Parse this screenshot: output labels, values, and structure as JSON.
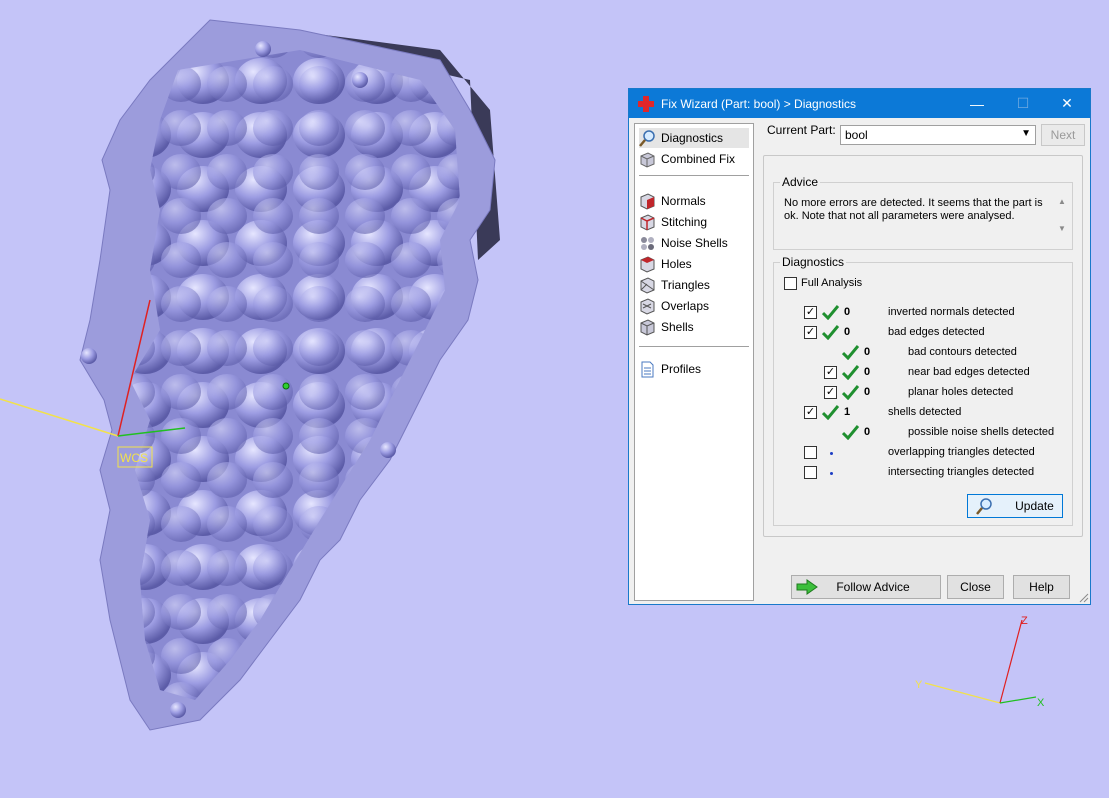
{
  "dialog": {
    "title": "Fix Wizard (Part: bool) > Diagnostics",
    "controls": {
      "minimize": "—",
      "maximize": "☐",
      "close": "✕"
    }
  },
  "nav": {
    "items": [
      {
        "label": "Diagnostics",
        "icon": "magnifier-icon",
        "selected": true
      },
      {
        "label": "Combined Fix",
        "icon": "combined-fix-icon"
      },
      {
        "label": "Normals",
        "icon": "normals-cube-icon"
      },
      {
        "label": "Stitching",
        "icon": "stitching-cube-icon"
      },
      {
        "label": "Noise Shells",
        "icon": "noise-shells-icon"
      },
      {
        "label": "Holes",
        "icon": "holes-cube-icon"
      },
      {
        "label": "Triangles",
        "icon": "triangles-cube-icon"
      },
      {
        "label": "Overlaps",
        "icon": "overlaps-cube-icon"
      },
      {
        "label": "Shells",
        "icon": "shells-cube-icon"
      },
      {
        "label": "Profiles",
        "icon": "document-icon"
      }
    ]
  },
  "current_part": {
    "label": "Current Part:",
    "value": "bool"
  },
  "next_label": "Next",
  "advice": {
    "legend": "Advice",
    "text": "No more errors are detected. It seems that the part is ok. Note that not all parameters were analysed."
  },
  "diagnostics": {
    "legend": "Diagnostics",
    "full_analysis": "Full Analysis",
    "rows": [
      {
        "count": "0",
        "label": "inverted normals detected"
      },
      {
        "count": "0",
        "label": "bad edges detected"
      },
      {
        "count": "0",
        "label": "bad contours detected"
      },
      {
        "count": "0",
        "label": "near bad edges detected"
      },
      {
        "count": "0",
        "label": "planar holes detected"
      },
      {
        "count": "1",
        "label": "shells detected"
      },
      {
        "count": "0",
        "label": "possible noise shells detected"
      },
      {
        "count": "",
        "label": "overlapping triangles detected"
      },
      {
        "count": "",
        "label": "intersecting triangles detected"
      }
    ],
    "update_label": "Update"
  },
  "buttons": {
    "follow_advice": "Follow Advice",
    "close": "Close",
    "help": "Help"
  },
  "viewport": {
    "wcs_label": "WCS",
    "axis_labels": {
      "x": "X",
      "y": "Y",
      "z": "Z"
    },
    "colors": {
      "background": "#c4c4f8",
      "model": "#9a9ae0",
      "accent": "#0c79d7"
    }
  }
}
